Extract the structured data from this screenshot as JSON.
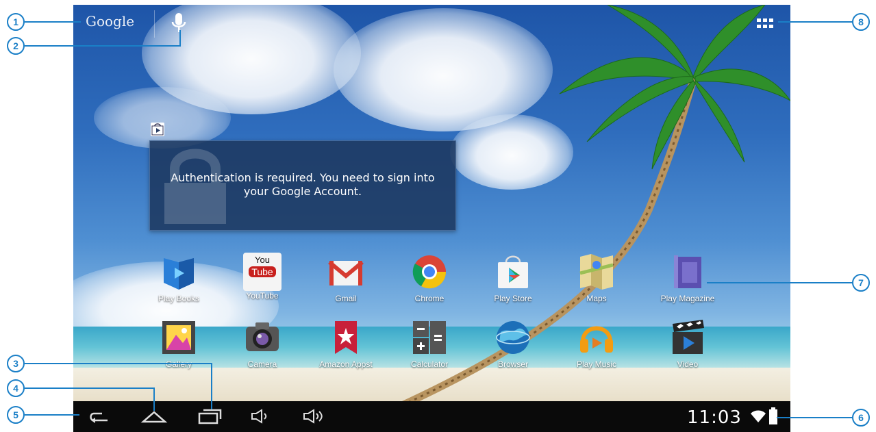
{
  "topbar": {
    "search_brand": "Google"
  },
  "notification": {
    "message": "Authentication is required. You need to sign into your Google Account."
  },
  "apps_row1": [
    {
      "label": "Play Books"
    },
    {
      "label": "YouTube"
    },
    {
      "label": "Gmail"
    },
    {
      "label": "Chrome"
    },
    {
      "label": "Play Store"
    },
    {
      "label": "Maps"
    },
    {
      "label": "Play Magazine"
    }
  ],
  "apps_row2": [
    {
      "label": "Gallery"
    },
    {
      "label": "Camera"
    },
    {
      "label": "Amazon Appst"
    },
    {
      "label": "Calculator"
    },
    {
      "label": "Browser"
    },
    {
      "label": "Play Music"
    },
    {
      "label": "Video"
    }
  ],
  "youtube_icon": {
    "top": "You",
    "bottom": "Tube"
  },
  "status": {
    "time": "11:03"
  },
  "callouts": [
    "1",
    "2",
    "3",
    "4",
    "5",
    "6",
    "7",
    "8"
  ],
  "icons": [
    "mic-icon",
    "apps-grid-icon",
    "back-icon",
    "home-icon",
    "recents-icon",
    "volume-down-icon",
    "volume-up-icon",
    "wifi-icon",
    "battery-icon"
  ],
  "colors": {
    "callout": "#1a7fc7",
    "navbar": "#0a0a0a"
  }
}
